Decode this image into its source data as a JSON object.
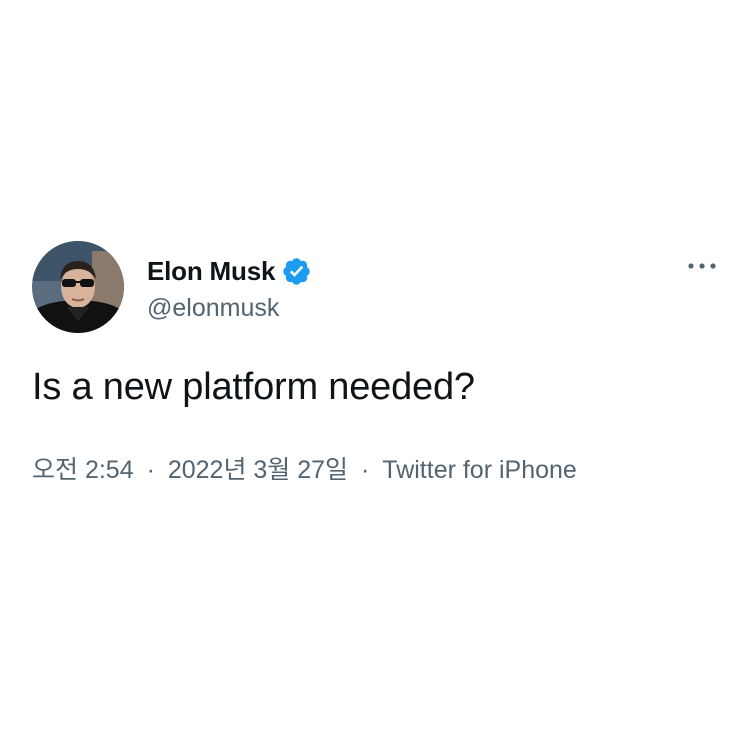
{
  "tweet": {
    "author": {
      "display_name": "Elon Musk",
      "handle": "@elonmusk",
      "verified": true,
      "avatar_icon": "profile-photo-avatar"
    },
    "more_icon": "more-horizontal-icon",
    "text": "Is a new platform needed?",
    "meta": {
      "time": "오전 2:54",
      "separator": "·",
      "date": "2022년 3월 27일",
      "source": "Twitter for iPhone"
    }
  },
  "colors": {
    "text_primary": "#0f1419",
    "text_secondary": "#536471",
    "verified_blue": "#1d9bf0",
    "background": "#ffffff"
  }
}
